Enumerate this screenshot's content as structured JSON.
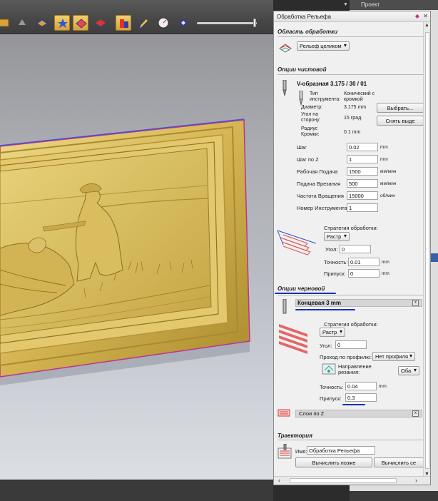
{
  "toolbar": {
    "icons": [
      "box-icon",
      "hand-icon",
      "relief-icon",
      "star-icon",
      "fill-icon",
      "layer-icon",
      "color-icon",
      "brush-icon",
      "gauge-icon",
      "diamond-icon"
    ]
  },
  "project_panel": {
    "tab_label": "Проект"
  },
  "panel": {
    "title": "Обработка Рельефа",
    "area": {
      "heading": "Область обработки",
      "selected": "Рельеф целиком"
    },
    "finish": {
      "heading": "Опции чистовой",
      "tool_name": "V-образная 3.175 / 30 / 01",
      "tool_type_label": "Тип инструмента:",
      "tool_type_value": "Конический с кромкой",
      "diameter_label": "Диаметр:",
      "diameter_value": "3.175 mm",
      "side_angle_label": "Угол на сторону:",
      "side_angle_value": "15 град.",
      "edge_radius_label": "Радиус Кромки:",
      "edge_radius_value": "0.1 mm",
      "select_button": "Выбрать...",
      "deselect_button": "Снять выде",
      "step_label": "Шаг",
      "step_value": "0.02",
      "step_unit": "mm",
      "stepz_label": "Шаг по Z",
      "stepz_value": "1",
      "stepz_unit": "mm",
      "feed_label": "Рабочая Подача",
      "feed_value": "1500",
      "feed_unit": "мм/мин",
      "plunge_label": "Подача Врезания",
      "plunge_value": "500",
      "plunge_unit": "мм/мин",
      "speed_label": "Частота Вращения",
      "speed_value": "15000",
      "speed_unit": "об/мин",
      "toolnum_label": "Номер Инструмента",
      "toolnum_value": "1",
      "strategy_label": "Стратегия обработки:",
      "strategy_value": "Растр",
      "angle_label": "Угол:",
      "angle_value": "0",
      "tolerance_label": "Точность:",
      "tolerance_value": "0.01",
      "tolerance_unit": "mm",
      "allowance_label": "Припуск:",
      "allowance_value": "0",
      "allowance_unit": "mm"
    },
    "rough": {
      "heading": "Опции черновой",
      "tool_name": "Концевая 3 mm",
      "strategy_label": "Стратегия обработки:",
      "strategy_value": "Растр",
      "angle_label": "Угол:",
      "angle_value": "0",
      "profile_label": "Проход по профилю:",
      "profile_value": "Нет профиля",
      "direction_label": "Направление резания:",
      "direction_value": "Оба",
      "tolerance_label": "Точность:",
      "tolerance_value": "0.04",
      "tolerance_unit": "mm",
      "allowance_label": "Припуск:",
      "allowance_value": "0.3",
      "zlevel_label": "Слои по Z"
    },
    "trajectory": {
      "heading": "Траектория",
      "name_label": "Имя:",
      "name_value": "Обработка Рельефа",
      "later_button": "Вычислить позже",
      "compute_button": "Вычислить се"
    }
  },
  "colors": {
    "accent_blue": "#1a2fb8",
    "relief_gold": "#d4b552",
    "frame_magenta": "#c0338a",
    "toolpath_red": "#e05050"
  }
}
